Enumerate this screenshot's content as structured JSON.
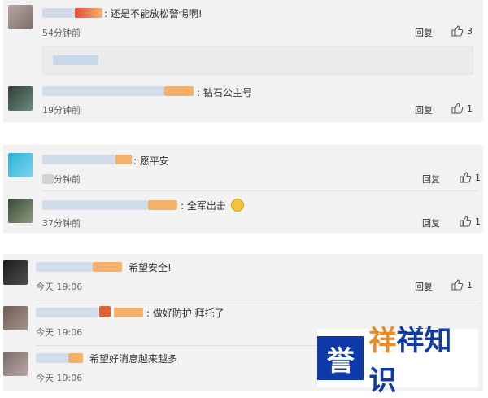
{
  "reply_label": "回复",
  "comments": [
    {
      "text": ": 还是不能放松警惕啊!",
      "time": "54分钟前",
      "likes": "3"
    },
    {
      "text": ": 钻石公主号",
      "time": "19分钟前",
      "likes": "1"
    },
    {
      "text": ": 愿平安",
      "time": "分钟前",
      "likes": "1"
    },
    {
      "text": ": 全军出击",
      "time": "37分钟前",
      "likes": "1"
    },
    {
      "text": "希望安全!",
      "time": "今天 19:06",
      "likes": "1"
    },
    {
      "text": ": 做好防护 拜托了",
      "time": "今天 19:06",
      "likes": ""
    },
    {
      "text": "希望好消息越来越多",
      "time": "今天 19:06",
      "likes": ""
    }
  ],
  "watermark": {
    "box": "誉",
    "orange": "祥",
    "rest": "祥知识"
  },
  "colors": {
    "brand_blue": "#0d3aa8",
    "brand_orange": "#f18a1c",
    "panel_bg": "#f2f2f2"
  }
}
